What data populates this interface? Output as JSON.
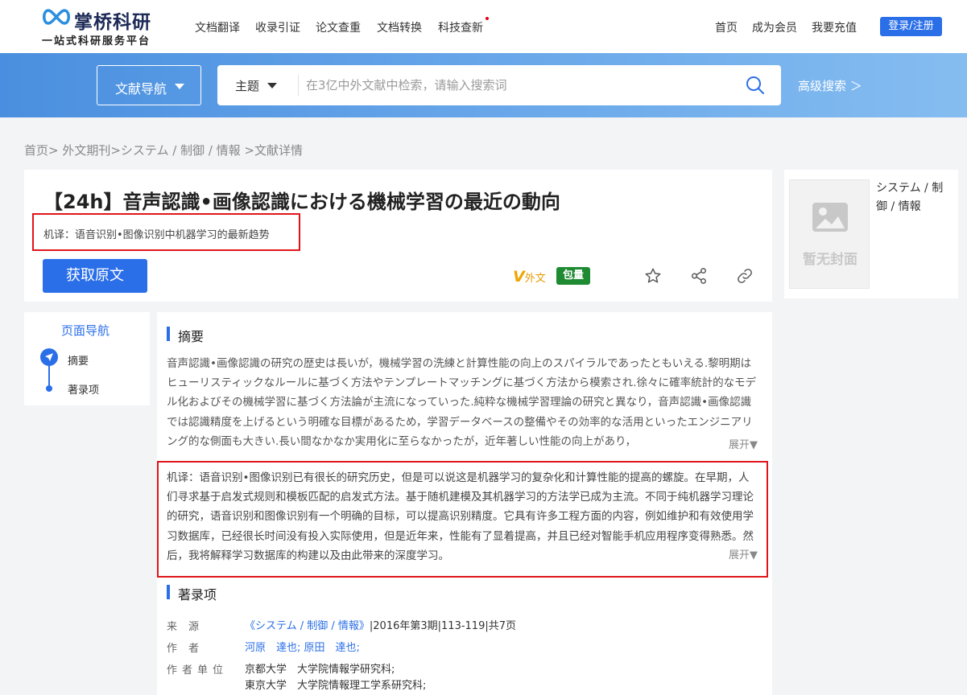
{
  "header": {
    "logo_name": "掌桥科研",
    "logo_slogan": "一站式科研服务平台",
    "nav": [
      "文档翻译",
      "收录引证",
      "论文查重",
      "文档转换",
      "科技查新"
    ],
    "right_nav": [
      "首页",
      "成为会员",
      "我要充值"
    ],
    "login_label": "登录/注册"
  },
  "search": {
    "lit_nav_label": "文献导航",
    "topic_label": "主题",
    "placeholder": "在3亿中外文献中检索，请输入搜索词",
    "advanced_label": "高级搜索 ＞"
  },
  "breadcrumb": "首页> 外文期刊>システム / 制御 / 情報 >文献详情",
  "article": {
    "title": "【24h】音声認識•画像認識における機械学習の最近の動向",
    "machine_translation": "机译：语音识别•图像识别中机器学习的最新趋势",
    "get_fulltext_label": "获取原文",
    "v_logo_letter": "V",
    "v_logo_text": "外文",
    "bundle_badge": "包量"
  },
  "cover": {
    "placeholder_text": "暂无封面",
    "category": "システム / 制御 / 情報"
  },
  "page_nav": {
    "title": "页面导航",
    "items": [
      "摘要",
      "著录项"
    ]
  },
  "abstract": {
    "heading": "摘要",
    "original": "音声認識•画像認識の研究の歴史は長いが，機械学習の洗練と計算性能の向上のスパイラルであったともいえる.黎明期はヒューリスティックなルールに基づく方法やテンプレートマッチングに基づく方法から模索され.徐々に確率統計的なモデル化およびその機械学習に基づく方法論が主流になっていった.純粋な機械学習理論の研究と異なり，音声認識•画像認識では認識精度を上げるという明確な目標があるため，学習データベースの整備やその効率的な活用といったエンジニアリング的な側面も大きい.長い間なかなか実用化に至らなかったが，近年著しい性能の向上があり，",
    "translation": "机译：语音识别•图像识别已有很长的研究历史，但是可以说这是机器学习的复杂化和计算性能的提高的螺旋。在早期，人们寻求基于启发式规则和模板匹配的启发式方法。基于随机建模及其机器学习的方法学已成为主流。不同于纯机器学习理论的研究，语音识别和图像识别有一个明确的目标，可以提高识别精度。它具有许多工程方面的内容，例如维护和有效使用学习数据库，已经很长时间没有投入实际使用，但是近年来，性能有了显着提高，并且已经对智能手机应用程序变得熟悉。然后，我将解释学习数据库的构建以及由此带来的深度学习。",
    "expand_label": "展开▼"
  },
  "record": {
    "heading": "著录项",
    "source_label": "来源",
    "source_link": "《システム / 制御 / 情報》",
    "source_detail": "|2016年第3期|113-119|共7页",
    "author_label": "作者",
    "authors": "河原　達也; 原田　達也;",
    "affiliation_label": "作者单位",
    "affiliations": [
      "京都大学　大学院情報学研究科;",
      "東京大学　大学院情報理工学系研究科;"
    ]
  },
  "colors": {
    "accent": "#2b6fe8",
    "highlight_border": "#e0151a",
    "badge_green": "#1e8a32"
  }
}
